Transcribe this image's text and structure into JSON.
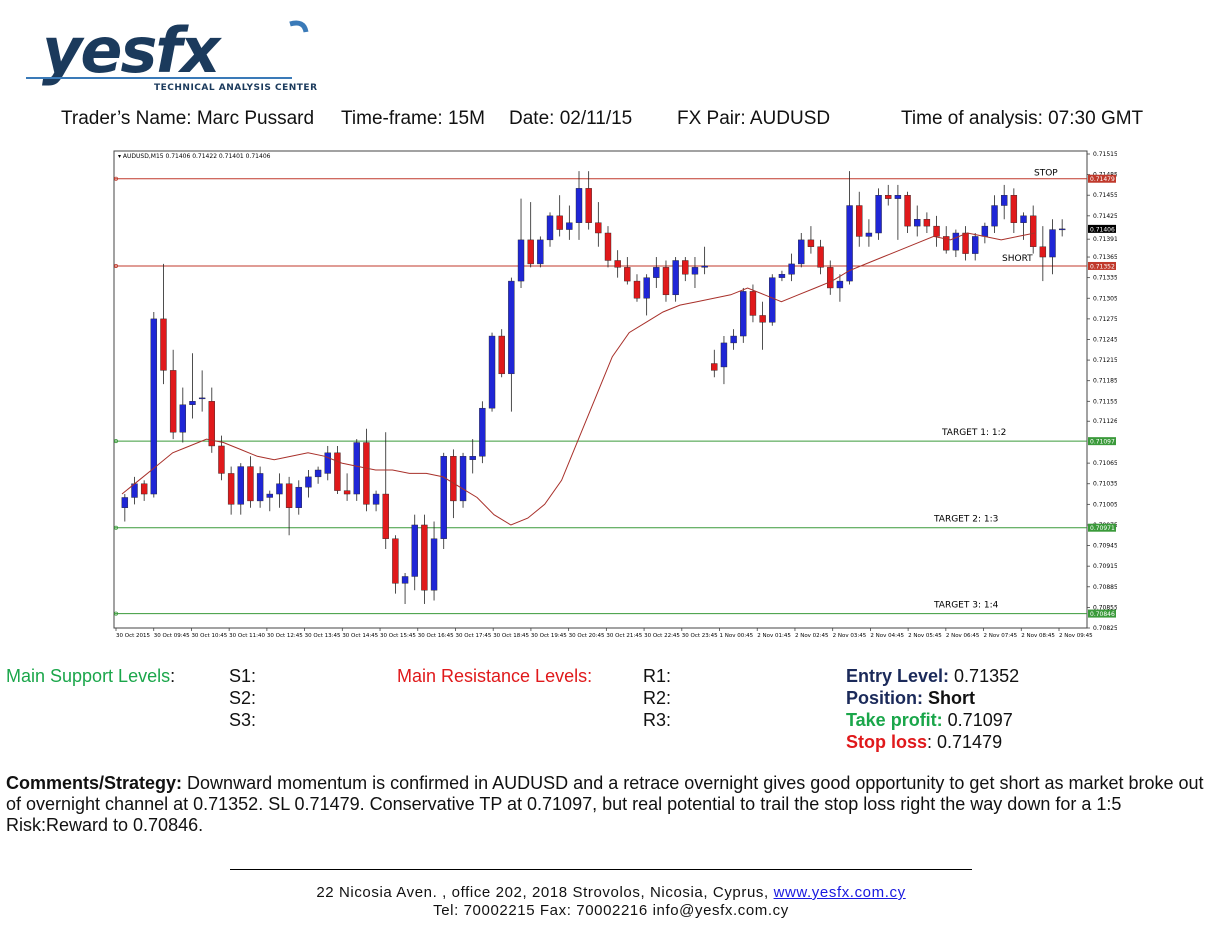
{
  "logo": {
    "brand": "yesfx",
    "tagline": "TECHNICAL ANALYSIS CENTER"
  },
  "info": {
    "trader": "Trader’s Name: Marc Pussard",
    "timeframe": "Time-frame:  15M",
    "date": "Date:  02/11/15",
    "pair": "FX Pair: AUDUSD",
    "time": "Time of analysis: 07:30 GMT"
  },
  "colors": {
    "bull": "#1f26d6",
    "bear": "#e0191b",
    "ma": "#a8302a",
    "resistance": "#c0392b",
    "target": "#3a9a3a",
    "brand_navy": "#1b3a5c",
    "brand_blue": "#3a7ab8"
  },
  "chart_data": {
    "type": "candlestick",
    "symbol_header": "AUDUSD,M15  0.71406 0.71422 0.71401 0.71406",
    "ylim": [
      0.70825,
      0.71515
    ],
    "y_ticks": [
      "0.71515",
      "0.71485",
      "0.71455",
      "0.71425",
      "0.71391",
      "0.71365",
      "0.71335",
      "0.71305",
      "0.71275",
      "0.71245",
      "0.71215",
      "0.71185",
      "0.71155",
      "0.71126",
      "0.71065",
      "0.71035",
      "0.71005",
      "0.70975",
      "0.70945",
      "0.70915",
      "0.70885",
      "0.70855",
      "0.70825"
    ],
    "x_labels": [
      "30 Oct 2015",
      "30 Oct 09:45",
      "30 Oct 10:45",
      "30 Oct 11:40",
      "30 Oct 12:45",
      "30 Oct 13:45",
      "30 Oct 14:45",
      "30 Oct 15:45",
      "30 Oct 16:45",
      "30 Oct 17:45",
      "30 Oct 18:45",
      "30 Oct 19:45",
      "30 Oct 20:45",
      "30 Oct 21:45",
      "30 Oct 22:45",
      "30 Oct 23:45",
      "1 Nov 00:45",
      "2 Nov 01:45",
      "2 Nov 02:45",
      "2 Nov 03:45",
      "2 Nov 04:45",
      "2 Nov 05:45",
      "2 Nov 06:45",
      "2 Nov 07:45",
      "2 Nov 08:45",
      "2 Nov 09:45"
    ],
    "current_price": "0.71406",
    "levels": [
      {
        "name": "STOP",
        "value": 0.71479,
        "tag": "0.71479",
        "kind": "stop"
      },
      {
        "name": "SHORT",
        "value": 0.71352,
        "tag": "0.71352",
        "kind": "entry"
      },
      {
        "name": "TARGET 1:    1:2",
        "value": 0.71097,
        "tag": "0.71097",
        "kind": "target"
      },
      {
        "name": "TARGET 2:    1:3",
        "value": 0.70971,
        "tag": "0.70971",
        "kind": "target"
      },
      {
        "name": "TARGET 3:    1:4",
        "value": 0.70846,
        "tag": "0.70846",
        "kind": "target"
      }
    ],
    "candles": [
      {
        "o": 0.71,
        "h": 0.7102,
        "l": 0.7098,
        "c": 0.71015
      },
      {
        "o": 0.71015,
        "h": 0.71045,
        "l": 0.71005,
        "c": 0.71035
      },
      {
        "o": 0.71035,
        "h": 0.7104,
        "l": 0.7101,
        "c": 0.7102
      },
      {
        "o": 0.7102,
        "h": 0.71285,
        "l": 0.71015,
        "c": 0.71275
      },
      {
        "o": 0.71275,
        "h": 0.71355,
        "l": 0.7118,
        "c": 0.712
      },
      {
        "o": 0.712,
        "h": 0.7123,
        "l": 0.711,
        "c": 0.7111
      },
      {
        "o": 0.7111,
        "h": 0.71175,
        "l": 0.71095,
        "c": 0.7115
      },
      {
        "o": 0.7115,
        "h": 0.71225,
        "l": 0.7113,
        "c": 0.71155
      },
      {
        "o": 0.7116,
        "h": 0.712,
        "l": 0.7114,
        "c": 0.7116
      },
      {
        "o": 0.71155,
        "h": 0.71175,
        "l": 0.7108,
        "c": 0.7109
      },
      {
        "o": 0.7109,
        "h": 0.71105,
        "l": 0.7104,
        "c": 0.7105
      },
      {
        "o": 0.7105,
        "h": 0.7106,
        "l": 0.7099,
        "c": 0.71005
      },
      {
        "o": 0.71005,
        "h": 0.71065,
        "l": 0.7099,
        "c": 0.7106
      },
      {
        "o": 0.7106,
        "h": 0.71075,
        "l": 0.71,
        "c": 0.7101
      },
      {
        "o": 0.7101,
        "h": 0.7106,
        "l": 0.71,
        "c": 0.7105
      },
      {
        "o": 0.71015,
        "h": 0.71025,
        "l": 0.70995,
        "c": 0.7102
      },
      {
        "o": 0.7102,
        "h": 0.7105,
        "l": 0.71,
        "c": 0.71035
      },
      {
        "o": 0.71035,
        "h": 0.71045,
        "l": 0.7096,
        "c": 0.71
      },
      {
        "o": 0.71,
        "h": 0.7104,
        "l": 0.7099,
        "c": 0.7103
      },
      {
        "o": 0.7103,
        "h": 0.71055,
        "l": 0.71015,
        "c": 0.71045
      },
      {
        "o": 0.71045,
        "h": 0.7106,
        "l": 0.71035,
        "c": 0.71055
      },
      {
        "o": 0.7105,
        "h": 0.7109,
        "l": 0.7104,
        "c": 0.7108
      },
      {
        "o": 0.7108,
        "h": 0.7109,
        "l": 0.7102,
        "c": 0.71025
      },
      {
        "o": 0.71025,
        "h": 0.7105,
        "l": 0.7101,
        "c": 0.7102
      },
      {
        "o": 0.7102,
        "h": 0.711,
        "l": 0.7101,
        "c": 0.71095
      },
      {
        "o": 0.71095,
        "h": 0.71115,
        "l": 0.70995,
        "c": 0.71005
      },
      {
        "o": 0.71005,
        "h": 0.71025,
        "l": 0.70995,
        "c": 0.7102
      },
      {
        "o": 0.7102,
        "h": 0.7111,
        "l": 0.7094,
        "c": 0.70955
      },
      {
        "o": 0.70955,
        "h": 0.7096,
        "l": 0.70875,
        "c": 0.7089
      },
      {
        "o": 0.7089,
        "h": 0.70905,
        "l": 0.7086,
        "c": 0.709
      },
      {
        "o": 0.709,
        "h": 0.7099,
        "l": 0.7088,
        "c": 0.70975
      },
      {
        "o": 0.70975,
        "h": 0.7099,
        "l": 0.7086,
        "c": 0.7088
      },
      {
        "o": 0.7088,
        "h": 0.7098,
        "l": 0.70865,
        "c": 0.70955
      },
      {
        "o": 0.70955,
        "h": 0.7108,
        "l": 0.7094,
        "c": 0.71075
      },
      {
        "o": 0.71075,
        "h": 0.71085,
        "l": 0.70985,
        "c": 0.7101
      },
      {
        "o": 0.7101,
        "h": 0.7108,
        "l": 0.71,
        "c": 0.71075
      },
      {
        "o": 0.7107,
        "h": 0.711,
        "l": 0.7105,
        "c": 0.71075
      },
      {
        "o": 0.71075,
        "h": 0.71155,
        "l": 0.71065,
        "c": 0.71145
      },
      {
        "o": 0.71145,
        "h": 0.71255,
        "l": 0.7114,
        "c": 0.7125
      },
      {
        "o": 0.7125,
        "h": 0.7126,
        "l": 0.7119,
        "c": 0.71195
      },
      {
        "o": 0.71195,
        "h": 0.71335,
        "l": 0.7114,
        "c": 0.7133
      },
      {
        "o": 0.7133,
        "h": 0.7145,
        "l": 0.7132,
        "c": 0.7139
      },
      {
        "o": 0.7139,
        "h": 0.71445,
        "l": 0.7135,
        "c": 0.71355
      },
      {
        "o": 0.71355,
        "h": 0.71395,
        "l": 0.7135,
        "c": 0.7139
      },
      {
        "o": 0.7139,
        "h": 0.7143,
        "l": 0.7138,
        "c": 0.71425
      },
      {
        "o": 0.71425,
        "h": 0.71455,
        "l": 0.71395,
        "c": 0.71405
      },
      {
        "o": 0.71405,
        "h": 0.7144,
        "l": 0.7139,
        "c": 0.71415
      },
      {
        "o": 0.71415,
        "h": 0.7149,
        "l": 0.7139,
        "c": 0.71465
      },
      {
        "o": 0.71465,
        "h": 0.7149,
        "l": 0.71405,
        "c": 0.71415
      },
      {
        "o": 0.71415,
        "h": 0.71445,
        "l": 0.7138,
        "c": 0.714
      },
      {
        "o": 0.714,
        "h": 0.7141,
        "l": 0.7135,
        "c": 0.7136
      },
      {
        "o": 0.7136,
        "h": 0.71375,
        "l": 0.71335,
        "c": 0.7135
      },
      {
        "o": 0.7135,
        "h": 0.71365,
        "l": 0.71325,
        "c": 0.7133
      },
      {
        "o": 0.7133,
        "h": 0.7134,
        "l": 0.713,
        "c": 0.71305
      },
      {
        "o": 0.71305,
        "h": 0.7134,
        "l": 0.7128,
        "c": 0.71335
      },
      {
        "o": 0.71335,
        "h": 0.71365,
        "l": 0.7132,
        "c": 0.7135
      },
      {
        "o": 0.7135,
        "h": 0.7136,
        "l": 0.713,
        "c": 0.7131
      },
      {
        "o": 0.7131,
        "h": 0.71365,
        "l": 0.713,
        "c": 0.7136
      },
      {
        "o": 0.7136,
        "h": 0.71365,
        "l": 0.7133,
        "c": 0.7134
      },
      {
        "o": 0.7134,
        "h": 0.71365,
        "l": 0.7132,
        "c": 0.7135
      },
      {
        "o": 0.7135,
        "h": 0.7138,
        "l": 0.7134,
        "c": 0.71352
      },
      {
        "o": 0.7121,
        "h": 0.7123,
        "l": 0.7119,
        "c": 0.712
      },
      {
        "o": 0.71205,
        "h": 0.7125,
        "l": 0.7118,
        "c": 0.7124
      },
      {
        "o": 0.7124,
        "h": 0.7126,
        "l": 0.7123,
        "c": 0.7125
      },
      {
        "o": 0.7125,
        "h": 0.7132,
        "l": 0.7124,
        "c": 0.71315
      },
      {
        "o": 0.71315,
        "h": 0.71325,
        "l": 0.7127,
        "c": 0.7128
      },
      {
        "o": 0.7128,
        "h": 0.713,
        "l": 0.7123,
        "c": 0.7127
      },
      {
        "o": 0.7127,
        "h": 0.7134,
        "l": 0.71265,
        "c": 0.71335
      },
      {
        "o": 0.71335,
        "h": 0.71345,
        "l": 0.7133,
        "c": 0.7134
      },
      {
        "o": 0.7134,
        "h": 0.7137,
        "l": 0.7133,
        "c": 0.71355
      },
      {
        "o": 0.71355,
        "h": 0.714,
        "l": 0.7135,
        "c": 0.7139
      },
      {
        "o": 0.7139,
        "h": 0.7141,
        "l": 0.7137,
        "c": 0.7138
      },
      {
        "o": 0.7138,
        "h": 0.7139,
        "l": 0.7134,
        "c": 0.7135
      },
      {
        "o": 0.7135,
        "h": 0.7136,
        "l": 0.7131,
        "c": 0.7132
      },
      {
        "o": 0.7132,
        "h": 0.7134,
        "l": 0.713,
        "c": 0.7133
      },
      {
        "o": 0.7133,
        "h": 0.7149,
        "l": 0.71325,
        "c": 0.7144
      },
      {
        "o": 0.7144,
        "h": 0.7146,
        "l": 0.7138,
        "c": 0.71395
      },
      {
        "o": 0.71395,
        "h": 0.7142,
        "l": 0.7138,
        "c": 0.714
      },
      {
        "o": 0.714,
        "h": 0.71465,
        "l": 0.7139,
        "c": 0.71455
      },
      {
        "o": 0.71455,
        "h": 0.7147,
        "l": 0.7144,
        "c": 0.7145
      },
      {
        "o": 0.7145,
        "h": 0.7147,
        "l": 0.7139,
        "c": 0.71455
      },
      {
        "o": 0.71455,
        "h": 0.7146,
        "l": 0.714,
        "c": 0.7141
      },
      {
        "o": 0.7141,
        "h": 0.7144,
        "l": 0.71395,
        "c": 0.7142
      },
      {
        "o": 0.7142,
        "h": 0.7143,
        "l": 0.714,
        "c": 0.7141
      },
      {
        "o": 0.7141,
        "h": 0.71425,
        "l": 0.7138,
        "c": 0.71395
      },
      {
        "o": 0.71395,
        "h": 0.7141,
        "l": 0.7137,
        "c": 0.71375
      },
      {
        "o": 0.71375,
        "h": 0.71405,
        "l": 0.71365,
        "c": 0.714
      },
      {
        "o": 0.714,
        "h": 0.7141,
        "l": 0.7136,
        "c": 0.7137
      },
      {
        "o": 0.7137,
        "h": 0.714,
        "l": 0.7136,
        "c": 0.71395
      },
      {
        "o": 0.71395,
        "h": 0.71415,
        "l": 0.71385,
        "c": 0.7141
      },
      {
        "o": 0.7141,
        "h": 0.71455,
        "l": 0.714,
        "c": 0.7144
      },
      {
        "o": 0.7144,
        "h": 0.7147,
        "l": 0.7142,
        "c": 0.71455
      },
      {
        "o": 0.71455,
        "h": 0.71465,
        "l": 0.714,
        "c": 0.71415
      },
      {
        "o": 0.71415,
        "h": 0.7143,
        "l": 0.7139,
        "c": 0.71425
      },
      {
        "o": 0.71425,
        "h": 0.7144,
        "l": 0.7137,
        "c": 0.7138
      },
      {
        "o": 0.7138,
        "h": 0.7141,
        "l": 0.7133,
        "c": 0.71365
      },
      {
        "o": 0.71365,
        "h": 0.7142,
        "l": 0.7134,
        "c": 0.71405
      },
      {
        "o": 0.71405,
        "h": 0.7142,
        "l": 0.71395,
        "c": 0.71406
      }
    ],
    "ma": [
      0.7102,
      0.7104,
      0.7106,
      0.7108,
      0.7109,
      0.711,
      0.71095,
      0.71085,
      0.71075,
      0.7107,
      0.71075,
      0.7108,
      0.71075,
      0.71065,
      0.7106,
      0.71055,
      0.71055,
      0.7105,
      0.7105,
      0.71045,
      0.7103,
      0.71015,
      0.7099,
      0.70975,
      0.70985,
      0.71005,
      0.7104,
      0.711,
      0.7116,
      0.7122,
      0.71255,
      0.7127,
      0.71285,
      0.71295,
      0.713,
      0.71305,
      0.7131,
      0.7132,
      0.7131,
      0.713,
      0.7131,
      0.7132,
      0.7133,
      0.71345,
      0.71355,
      0.71365,
      0.71375,
      0.71385,
      0.71395,
      0.7139,
      0.714,
      0.71395,
      0.7139,
      0.71395,
      0.714
    ]
  },
  "levels_section": {
    "support_label": "Main Support Levels",
    "support_colon": ":",
    "s1": "S1:",
    "s2": "S2:",
    "s3": "S3:",
    "resistance_label": "Main Resistance Levels:",
    "r1": "R1:",
    "r2": "R2:",
    "r3": "R3:",
    "entry_label": "Entry Level:",
    "entry_value": " 0.71352",
    "position_label": "Position:",
    "position_value": " Short",
    "tp_label": "Take profit:",
    "tp_value": " 0.71097",
    "sl_label": "Stop loss",
    "sl_value": ": 0.71479"
  },
  "comments": {
    "label": "Comments/Strategy:",
    "text": " Downward momentum is confirmed in AUDUSD and a retrace overnight gives good opportunity to get short as market broke out of overnight channel at 0.71352. SL 0.71479. Conservative TP at 0.71097, but real potential to trail the stop loss right the way down for a 1:5 Risk:Reward to 0.70846."
  },
  "footer": {
    "address": "22 Nicosia Aven. ,  office 202,  2018 Strovolos,  Nicosia,  Cyprus,  ",
    "website": "www.yesfx.com.cy",
    "contact": "Tel:  70002215  Fax:  70002216  info@yesfx.com.cy"
  }
}
